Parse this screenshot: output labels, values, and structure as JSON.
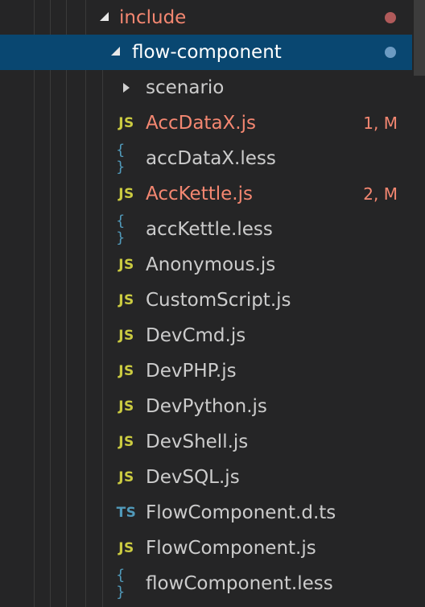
{
  "colors": {
    "background": "#252526",
    "selection": "#094771",
    "error_text": "#f48771",
    "modified_text": "#e2c08d",
    "js_icon": "#cbcb41",
    "less_icon": "#519aba",
    "ts_icon": "#519aba",
    "include_dot": "#b05a5a",
    "selected_dot": "#6c9bc2"
  },
  "tree": {
    "include": {
      "label": "include",
      "expanded": true
    },
    "flow_component": {
      "label": "flow-component",
      "expanded": true,
      "selected": true
    },
    "scenario": {
      "label": "scenario",
      "expanded": false
    },
    "files": [
      {
        "label": "AccDataX.js",
        "icon": "JS",
        "icon_name": "js-icon",
        "badge": "1, M",
        "status": "error"
      },
      {
        "label": "accDataX.less",
        "icon": "{ }",
        "icon_name": "less-braces-icon"
      },
      {
        "label": "AccKettle.js",
        "icon": "JS",
        "icon_name": "js-icon",
        "badge": "2, M",
        "status": "error"
      },
      {
        "label": "accKettle.less",
        "icon": "{ }",
        "icon_name": "less-braces-icon"
      },
      {
        "label": "Anonymous.js",
        "icon": "JS",
        "icon_name": "js-icon"
      },
      {
        "label": "CustomScript.js",
        "icon": "JS",
        "icon_name": "js-icon"
      },
      {
        "label": "DevCmd.js",
        "icon": "JS",
        "icon_name": "js-icon"
      },
      {
        "label": "DevPHP.js",
        "icon": "JS",
        "icon_name": "js-icon"
      },
      {
        "label": "DevPython.js",
        "icon": "JS",
        "icon_name": "js-icon"
      },
      {
        "label": "DevShell.js",
        "icon": "JS",
        "icon_name": "js-icon"
      },
      {
        "label": "DevSQL.js",
        "icon": "JS",
        "icon_name": "js-icon"
      },
      {
        "label": "FlowComponent.d.ts",
        "icon": "TS",
        "icon_name": "ts-icon"
      },
      {
        "label": "FlowComponent.js",
        "icon": "JS",
        "icon_name": "js-icon"
      },
      {
        "label": "flowComponent.less",
        "icon": "{ }",
        "icon_name": "less-braces-icon"
      }
    ]
  }
}
